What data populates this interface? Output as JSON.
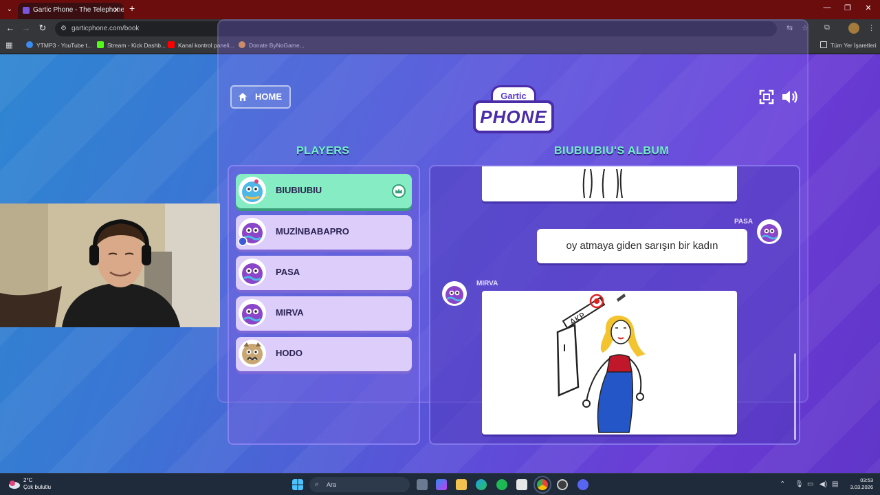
{
  "browser": {
    "tab_title": "Gartic Phone - The Telephone G",
    "url": "garticphone.com/book",
    "bookmarks": [
      "YTMP3 - YouTube t...",
      "Stream - Kick Dashb...",
      "Kanal kontrol paneli...",
      "Donate ByNoGame..."
    ],
    "all_bookmarks": "Tüm Yer İşaretleri"
  },
  "game": {
    "home_label": "HOME",
    "logo_top": "Gartic",
    "logo_main": "PHONE",
    "players_title": "PLAYERS",
    "album_title": "BIUBIUBIU'S ALBUM",
    "players": [
      {
        "name": "BIUBIUBIU",
        "active": true
      },
      {
        "name": "MUZİNBABAPRO",
        "active": false
      },
      {
        "name": "PASA",
        "active": false
      },
      {
        "name": "MIRVA",
        "active": false
      },
      {
        "name": "HODO",
        "active": false
      }
    ],
    "album": {
      "text_author": "PASA",
      "text_entry": "oy atmaya giden sarışın bir kadın",
      "drawing_author": "MIRVA",
      "drawing_sign_text": "AKP"
    }
  },
  "taskbar": {
    "temp": "2°C",
    "weather": "Çok bulutlu",
    "search_placeholder": "Ara",
    "time": "03:53",
    "date": "3.03.2026"
  },
  "colors": {
    "accent_green": "#6ff2c1",
    "active_player": "#86ecc3",
    "player_card": "#dccdfb"
  }
}
